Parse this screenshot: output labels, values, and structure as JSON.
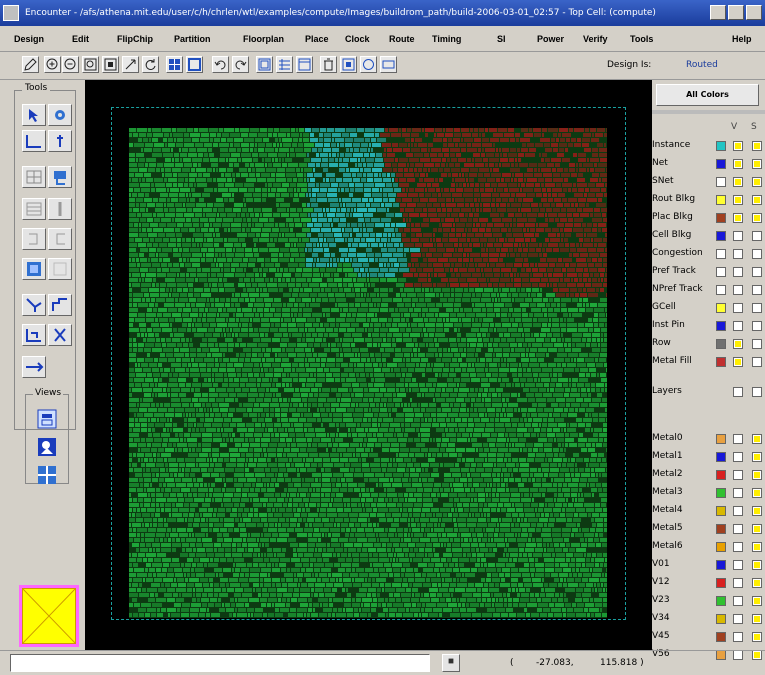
{
  "window": {
    "title": "Encounter - /afs/athena.mit.edu/user/c/h/chrlen/wtl/examples/compute/Images/buildrom_path/build-2006-03-01_02:57 - Top Cell: (compute)"
  },
  "menu": [
    "Design",
    "Edit",
    "FlipChip",
    "Partition",
    "Floorplan",
    "Place",
    "Clock",
    "Route",
    "Timing",
    "SI",
    "Power",
    "Verify",
    "Tools",
    "Help"
  ],
  "toolbar": {
    "design_is_label": "Design Is:",
    "design_state": "Routed"
  },
  "left_panel": {
    "tools_label": "Tools",
    "views_label": "Views"
  },
  "right_panel": {
    "all_colors_button": "All Colors",
    "col_v": "V",
    "col_s": "S",
    "objects": [
      {
        "name": "Instance",
        "color": "#22c4c4",
        "v": true,
        "s": true
      },
      {
        "name": "Net",
        "color": "#1818d8",
        "v": true,
        "s": true
      },
      {
        "name": "SNet",
        "color": "#ffffff",
        "v": true,
        "s": true
      },
      {
        "name": "Rout Blkg",
        "color": "#ffff33",
        "v": true,
        "s": true
      },
      {
        "name": "Plac Blkg",
        "color": "#a04020",
        "v": true,
        "s": true
      },
      {
        "name": "Cell Blkg",
        "color": "#1818d8",
        "v": false,
        "s": false
      },
      {
        "name": "Congestion",
        "color": "#ffffff",
        "v": false,
        "s": false
      },
      {
        "name": "Pref Track",
        "color": "#ffffff",
        "v": false,
        "s": false
      },
      {
        "name": "NPref Track",
        "color": "#ffffff",
        "v": false,
        "s": false
      },
      {
        "name": "GCell",
        "color": "#ffff33",
        "v": false,
        "s": false
      },
      {
        "name": "Inst Pin",
        "color": "#1818d8",
        "v": false,
        "s": false
      },
      {
        "name": "Row",
        "color": "#707070",
        "v": true,
        "s": false
      },
      {
        "name": "Metal Fill",
        "color": "#c03030",
        "v": true,
        "s": false
      }
    ],
    "layers_label": "Layers",
    "layers": [
      {
        "name": "Metal0",
        "color": "#e8a040",
        "v": false,
        "s": true
      },
      {
        "name": "Metal1",
        "color": "#1818d8",
        "v": false,
        "s": true
      },
      {
        "name": "Metal2",
        "color": "#d82020",
        "v": false,
        "s": true
      },
      {
        "name": "Metal3",
        "color": "#30c030",
        "v": false,
        "s": true
      },
      {
        "name": "Metal4",
        "color": "#d8b800",
        "v": false,
        "s": true
      },
      {
        "name": "Metal5",
        "color": "#a04020",
        "v": false,
        "s": true
      },
      {
        "name": "Metal6",
        "color": "#e8a000",
        "v": false,
        "s": true
      },
      {
        "name": "V01",
        "color": "#1818d8",
        "v": false,
        "s": true
      },
      {
        "name": "V12",
        "color": "#d82020",
        "v": false,
        "s": true
      },
      {
        "name": "V23",
        "color": "#30c030",
        "v": false,
        "s": true
      },
      {
        "name": "V34",
        "color": "#d8b800",
        "v": false,
        "s": true
      },
      {
        "name": "V45",
        "color": "#a04020",
        "v": false,
        "s": true
      },
      {
        "name": "V56",
        "color": "#e8a040",
        "v": false,
        "s": true
      }
    ]
  },
  "status": {
    "command_value": "",
    "coord_open": "(",
    "coord_x": "-27.083,",
    "coord_y": "115.818 )"
  },
  "layout_colors": {
    "background": "#000000",
    "core_cells": "#1fa83a",
    "instance_region": "#2ab6b8",
    "placement_blockage": "#8a2018",
    "die_outline": "#1aa0a0"
  }
}
